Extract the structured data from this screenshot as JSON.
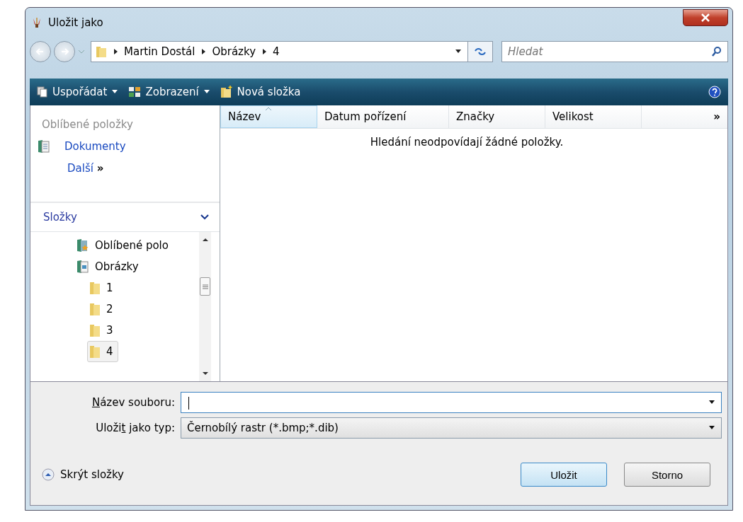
{
  "window": {
    "title": "Uložit jako"
  },
  "address": {
    "crumbs": [
      "Martin Dostál",
      "Obrázky",
      "4"
    ]
  },
  "search": {
    "placeholder": "Hledat"
  },
  "toolbar": {
    "items": [
      {
        "kind": "organize",
        "label": "Uspořádat"
      },
      {
        "kind": "views",
        "label": "Zobrazení"
      },
      {
        "kind": "newfolder",
        "label": "Nová složka"
      }
    ]
  },
  "favorites": {
    "heading": "Oblíbené položky",
    "items": [
      {
        "label": "Dokumenty"
      }
    ],
    "more": "Další",
    "more_mark": "»"
  },
  "folders": {
    "heading": "Složky",
    "expanded": true,
    "tree": [
      {
        "label": "Oblíbené polo",
        "kind": "favorites",
        "selected": false
      },
      {
        "label": "Obrázky",
        "kind": "pictures",
        "selected": false,
        "children": [
          {
            "label": "1",
            "kind": "folder",
            "selected": false
          },
          {
            "label": "2",
            "kind": "folder",
            "selected": false
          },
          {
            "label": "3",
            "kind": "folder",
            "selected": false
          },
          {
            "label": "4",
            "kind": "folder",
            "selected": true
          }
        ]
      }
    ]
  },
  "table": {
    "columns": [
      {
        "label": "Název",
        "sorted": true
      },
      {
        "label": "Datum pořízení",
        "sorted": false
      },
      {
        "label": "Značky",
        "sorted": false
      },
      {
        "label": "Velikost",
        "sorted": false
      }
    ],
    "more": "»",
    "empty_message": "Hledání neodpovídají žádné položky."
  },
  "form": {
    "fields": [
      {
        "kind": "combo",
        "label_key": "N",
        "label_after": "ázev souboru:",
        "focused": true
      },
      {
        "kind": "select",
        "label_before": "Uloži",
        "label_key": "t",
        "label_after": " jako typ:",
        "value": "Černobílý rastr (*.bmp;*.dib)",
        "focused": false
      }
    ]
  },
  "hide_folders": "Skrýt složky",
  "buttons": [
    {
      "label": "Uložit",
      "default": true
    },
    {
      "label": "Storno",
      "default": false
    }
  ]
}
